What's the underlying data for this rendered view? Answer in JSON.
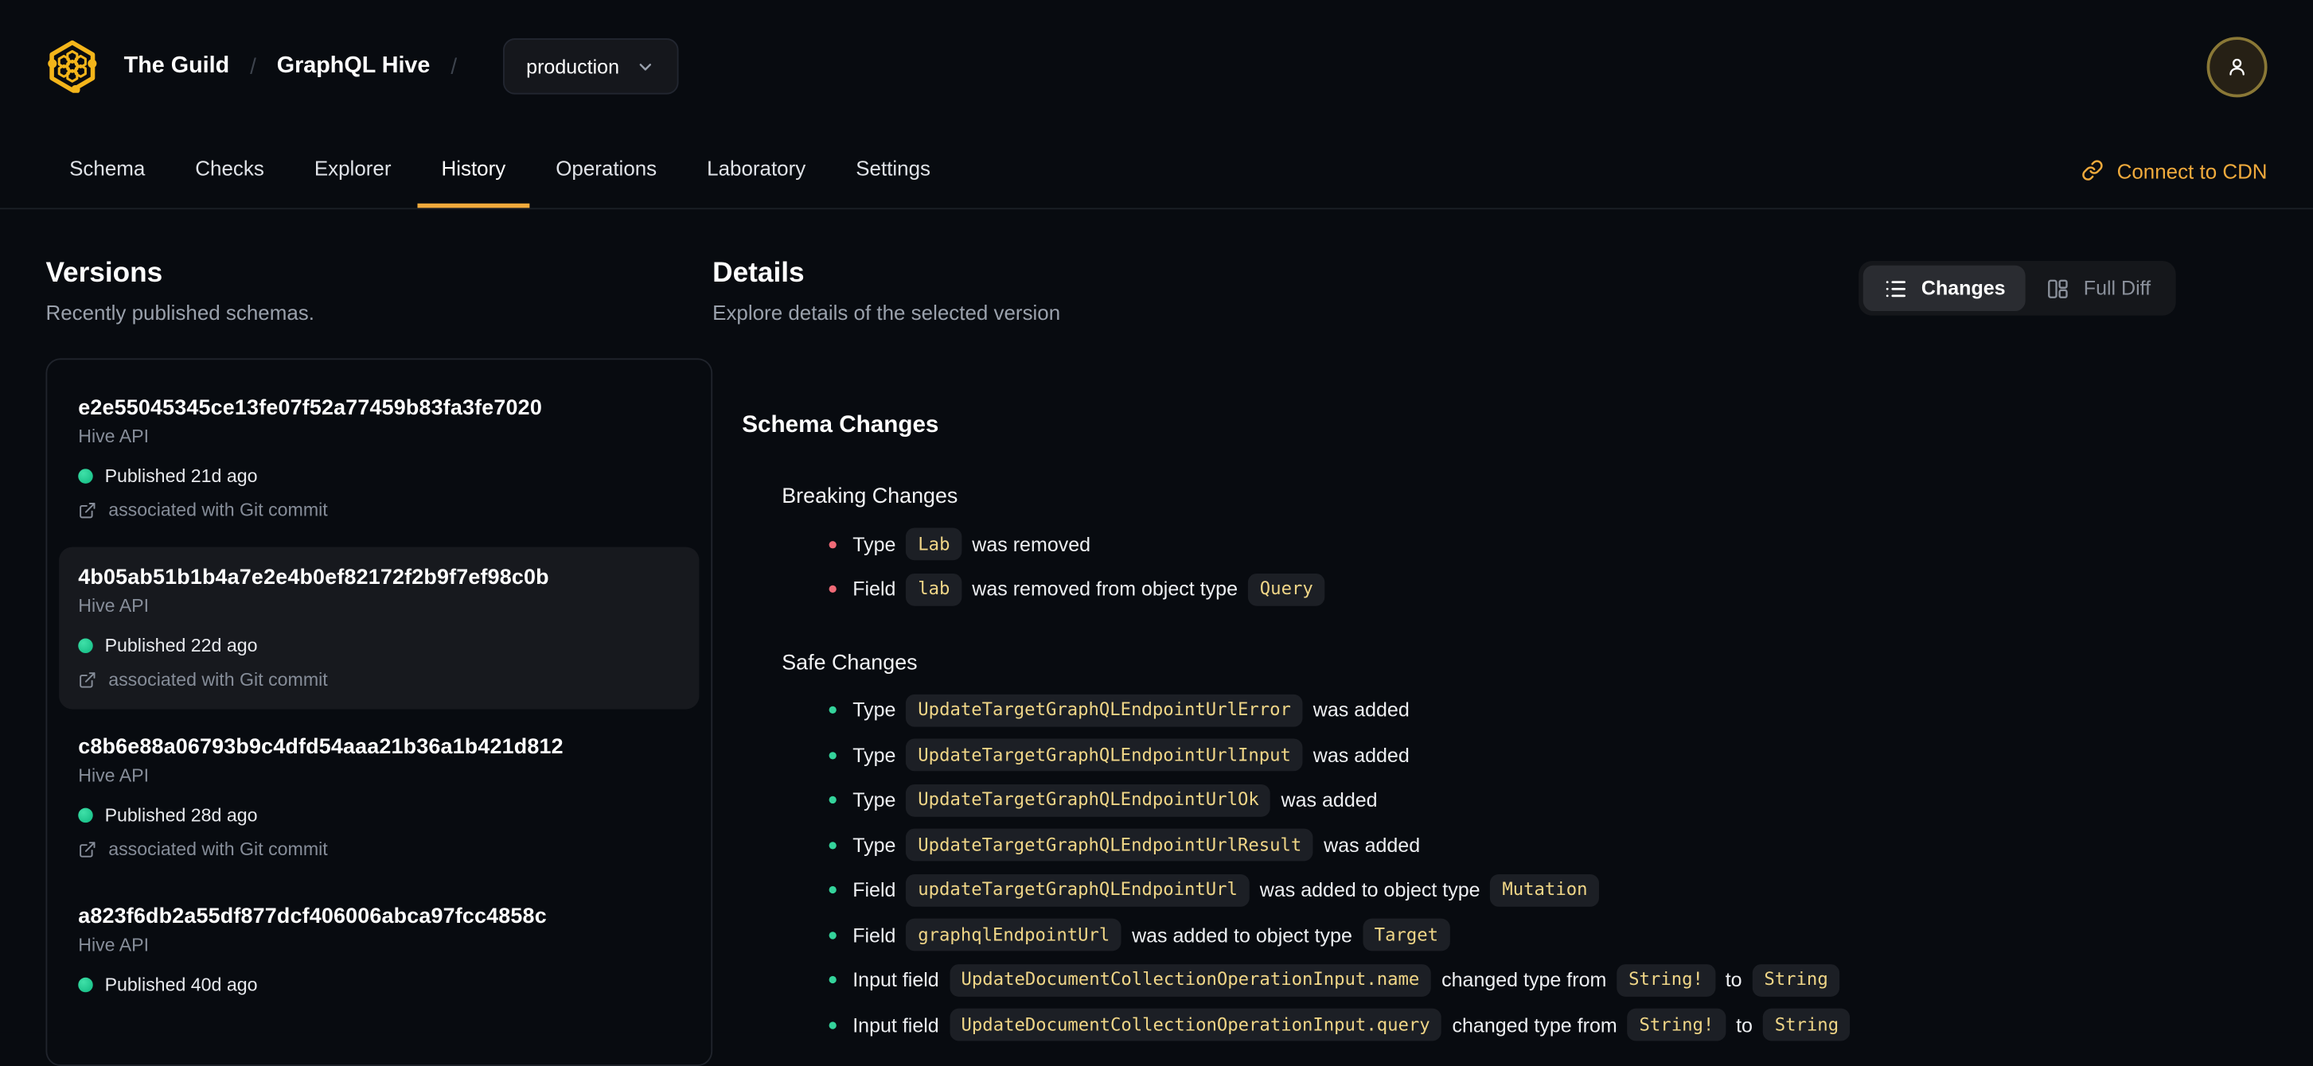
{
  "header": {
    "org": "The Guild",
    "project": "GraphQL Hive",
    "separator": "/",
    "target": "production",
    "connect_cdn": "Connect to CDN"
  },
  "tabs": [
    {
      "label": "Schema",
      "active": false
    },
    {
      "label": "Checks",
      "active": false
    },
    {
      "label": "Explorer",
      "active": false
    },
    {
      "label": "History",
      "active": true
    },
    {
      "label": "Operations",
      "active": false
    },
    {
      "label": "Laboratory",
      "active": false
    },
    {
      "label": "Settings",
      "active": false
    }
  ],
  "versions": {
    "title": "Versions",
    "subtitle": "Recently published schemas.",
    "items": [
      {
        "hash": "e2e55045345ce13fe07f52a77459b83fa3fe7020",
        "service": "Hive API",
        "published": "Published 21d ago",
        "git": "associated with Git commit",
        "selected": false
      },
      {
        "hash": "4b05ab51b1b4a7e2e4b0ef82172f2b9f7ef98c0b",
        "service": "Hive API",
        "published": "Published 22d ago",
        "git": "associated with Git commit",
        "selected": true
      },
      {
        "hash": "c8b6e88a06793b9c4dfd54aaa21b36a1b421d812",
        "service": "Hive API",
        "published": "Published 28d ago",
        "git": "associated with Git commit",
        "selected": false
      },
      {
        "hash": "a823f6db2a55df877dcf406006abca97fcc4858c",
        "service": "Hive API",
        "published": "Published 40d ago",
        "git": null,
        "selected": false
      }
    ]
  },
  "details": {
    "title": "Details",
    "subtitle": "Explore details of the selected version",
    "view_toggle": {
      "changes_label": "Changes",
      "full_diff_label": "Full Diff",
      "active": "changes"
    },
    "section_title": "Schema Changes",
    "breaking": {
      "title": "Breaking Changes",
      "rows": [
        [
          {
            "k": "t",
            "v": "Type"
          },
          {
            "k": "c",
            "v": "Lab"
          },
          {
            "k": "t",
            "v": "was removed"
          }
        ],
        [
          {
            "k": "t",
            "v": "Field"
          },
          {
            "k": "c",
            "v": "lab"
          },
          {
            "k": "t",
            "v": "was removed from object type"
          },
          {
            "k": "c",
            "v": "Query"
          }
        ]
      ]
    },
    "safe": {
      "title": "Safe Changes",
      "rows": [
        [
          {
            "k": "t",
            "v": "Type"
          },
          {
            "k": "c",
            "v": "UpdateTargetGraphQLEndpointUrlError"
          },
          {
            "k": "t",
            "v": "was added"
          }
        ],
        [
          {
            "k": "t",
            "v": "Type"
          },
          {
            "k": "c",
            "v": "UpdateTargetGraphQLEndpointUrlInput"
          },
          {
            "k": "t",
            "v": "was added"
          }
        ],
        [
          {
            "k": "t",
            "v": "Type"
          },
          {
            "k": "c",
            "v": "UpdateTargetGraphQLEndpointUrlOk"
          },
          {
            "k": "t",
            "v": "was added"
          }
        ],
        [
          {
            "k": "t",
            "v": "Type"
          },
          {
            "k": "c",
            "v": "UpdateTargetGraphQLEndpointUrlResult"
          },
          {
            "k": "t",
            "v": "was added"
          }
        ],
        [
          {
            "k": "t",
            "v": "Field"
          },
          {
            "k": "c",
            "v": "updateTargetGraphQLEndpointUrl"
          },
          {
            "k": "t",
            "v": "was added to object type"
          },
          {
            "k": "c",
            "v": "Mutation"
          }
        ],
        [
          {
            "k": "t",
            "v": "Field"
          },
          {
            "k": "c",
            "v": "graphqlEndpointUrl"
          },
          {
            "k": "t",
            "v": "was added to object type"
          },
          {
            "k": "c",
            "v": "Target"
          }
        ],
        [
          {
            "k": "t",
            "v": "Input field"
          },
          {
            "k": "c",
            "v": "UpdateDocumentCollectionOperationInput.name"
          },
          {
            "k": "t",
            "v": "changed type from"
          },
          {
            "k": "c",
            "v": "String!"
          },
          {
            "k": "t",
            "v": "to"
          },
          {
            "k": "c",
            "v": "String"
          }
        ],
        [
          {
            "k": "t",
            "v": "Input field"
          },
          {
            "k": "c",
            "v": "UpdateDocumentCollectionOperationInput.query"
          },
          {
            "k": "t",
            "v": "changed type from"
          },
          {
            "k": "c",
            "v": "String!"
          },
          {
            "k": "t",
            "v": "to"
          },
          {
            "k": "c",
            "v": "String"
          }
        ]
      ]
    }
  },
  "colors": {
    "accent": "#f0aa3c",
    "logo_yellow": "#f4b51a",
    "code_text": "#f0d687",
    "breaking_bullet": "#f06a77",
    "safe_bullet": "#34d39b",
    "published_dot": "#10b981"
  }
}
